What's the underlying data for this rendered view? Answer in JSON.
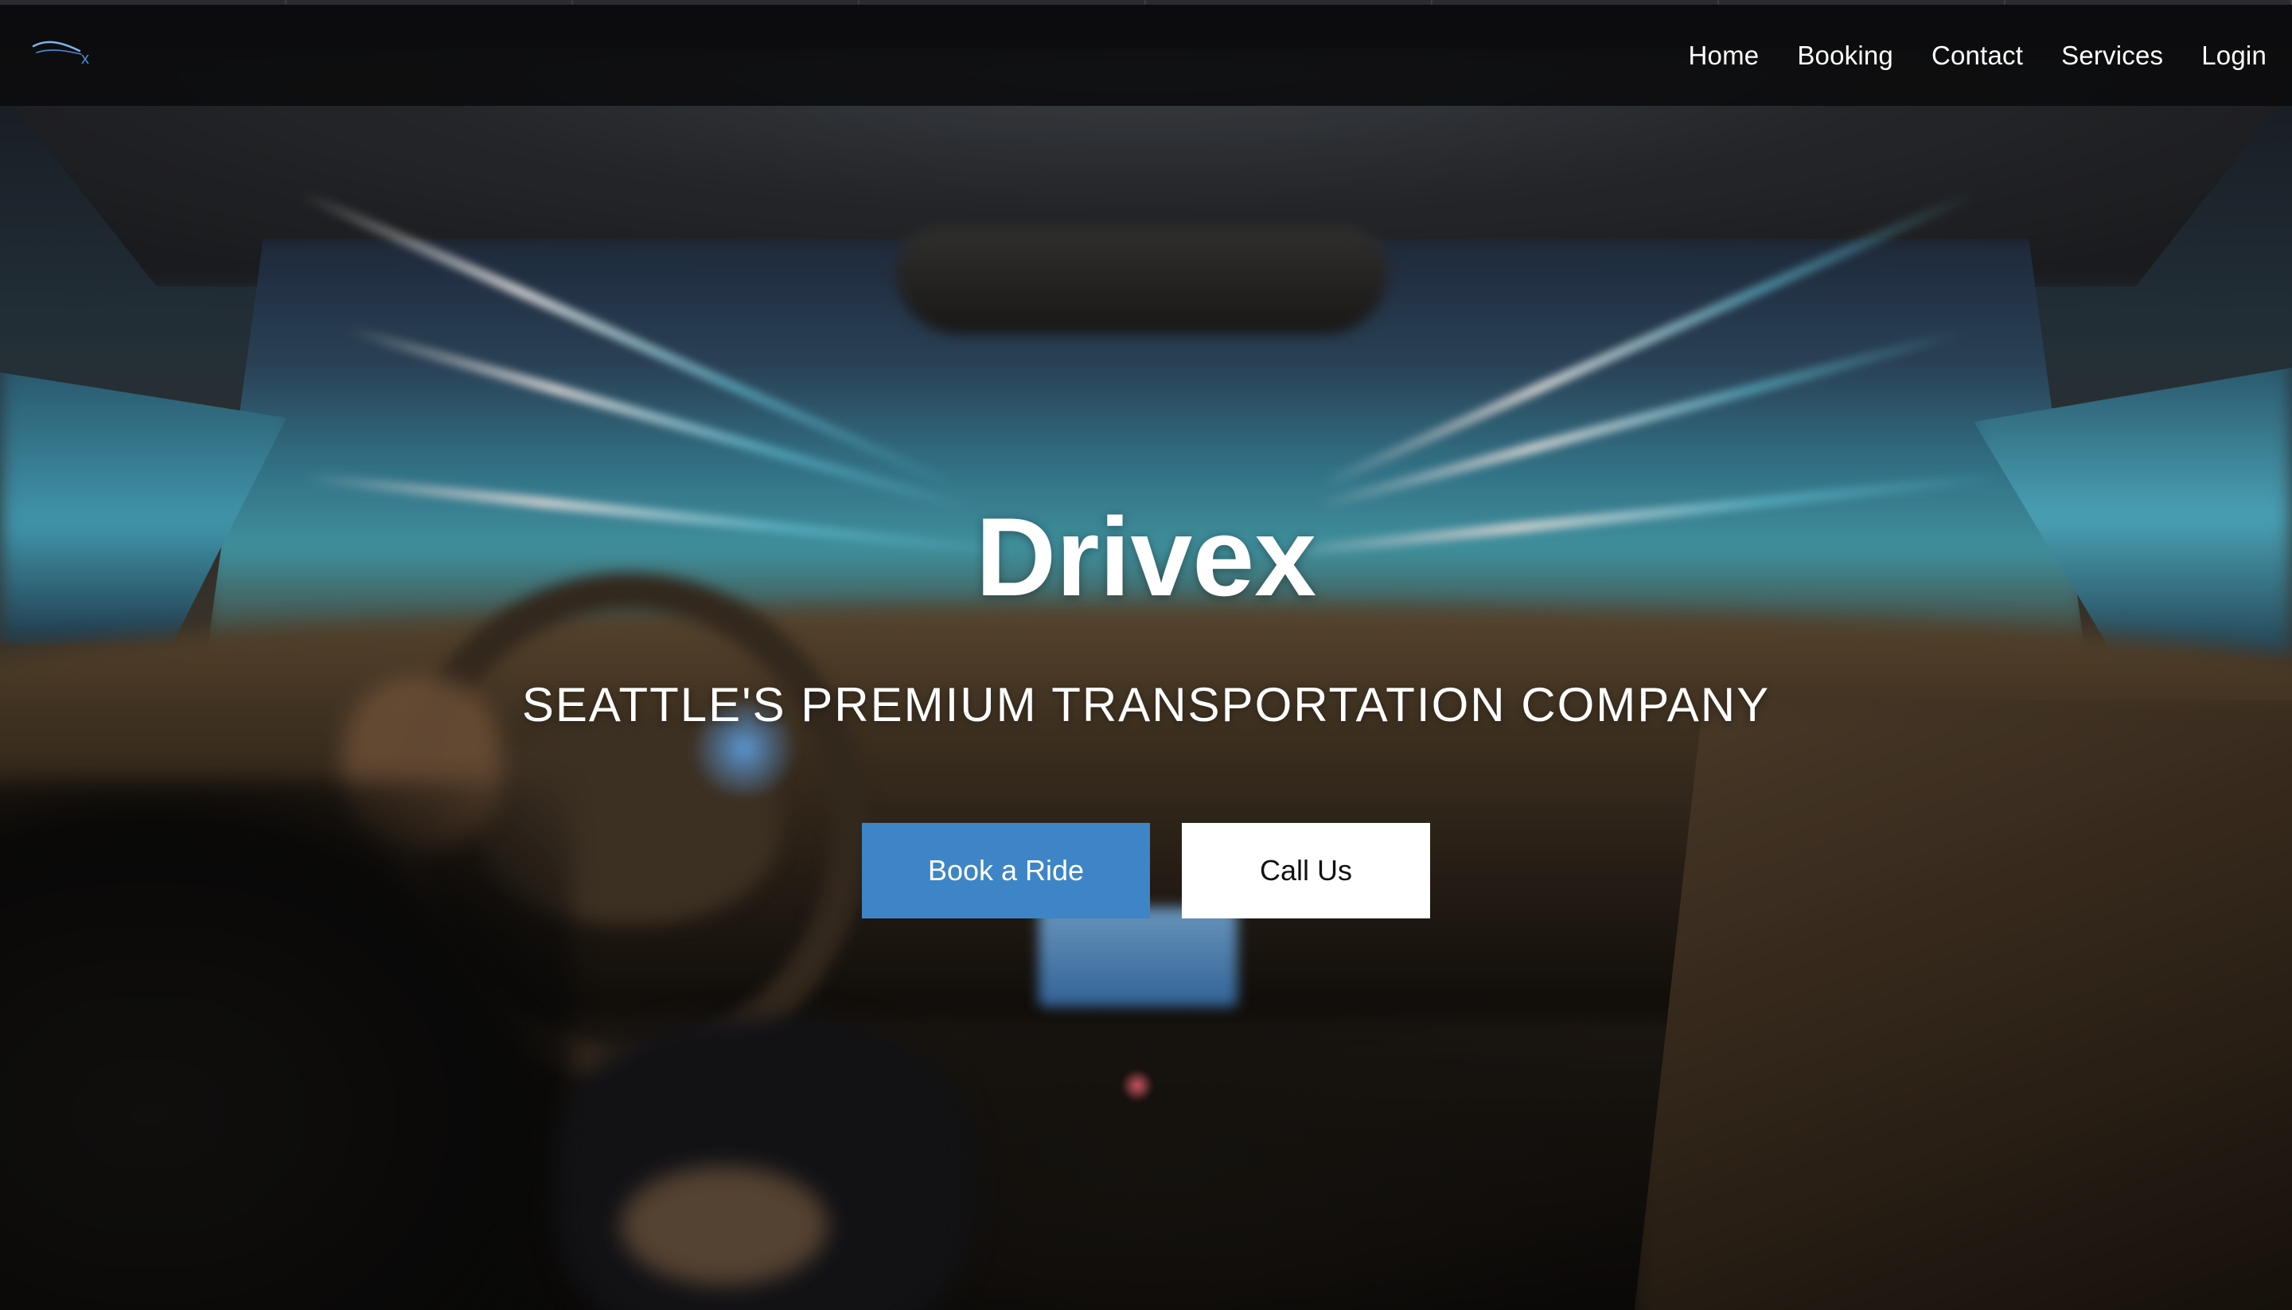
{
  "brand": {
    "logo_icon": "drivex-swoosh-logo",
    "logo_letter": "x",
    "accent_color": "#3d85c6"
  },
  "nav": {
    "items": [
      {
        "label": "Home"
      },
      {
        "label": "Booking"
      },
      {
        "label": "Contact"
      },
      {
        "label": "Services"
      },
      {
        "label": "Login"
      }
    ]
  },
  "hero": {
    "title": "Drivex",
    "subtitle": "SEATTLE'S PREMIUM TRANSPORTATION COMPANY",
    "primary_button": "Book a Ride",
    "secondary_button": "Call Us"
  },
  "colors": {
    "primary_button_bg": "#3d85c6",
    "secondary_button_bg": "#ffffff",
    "navbar_bg": "#0a0a0c"
  }
}
